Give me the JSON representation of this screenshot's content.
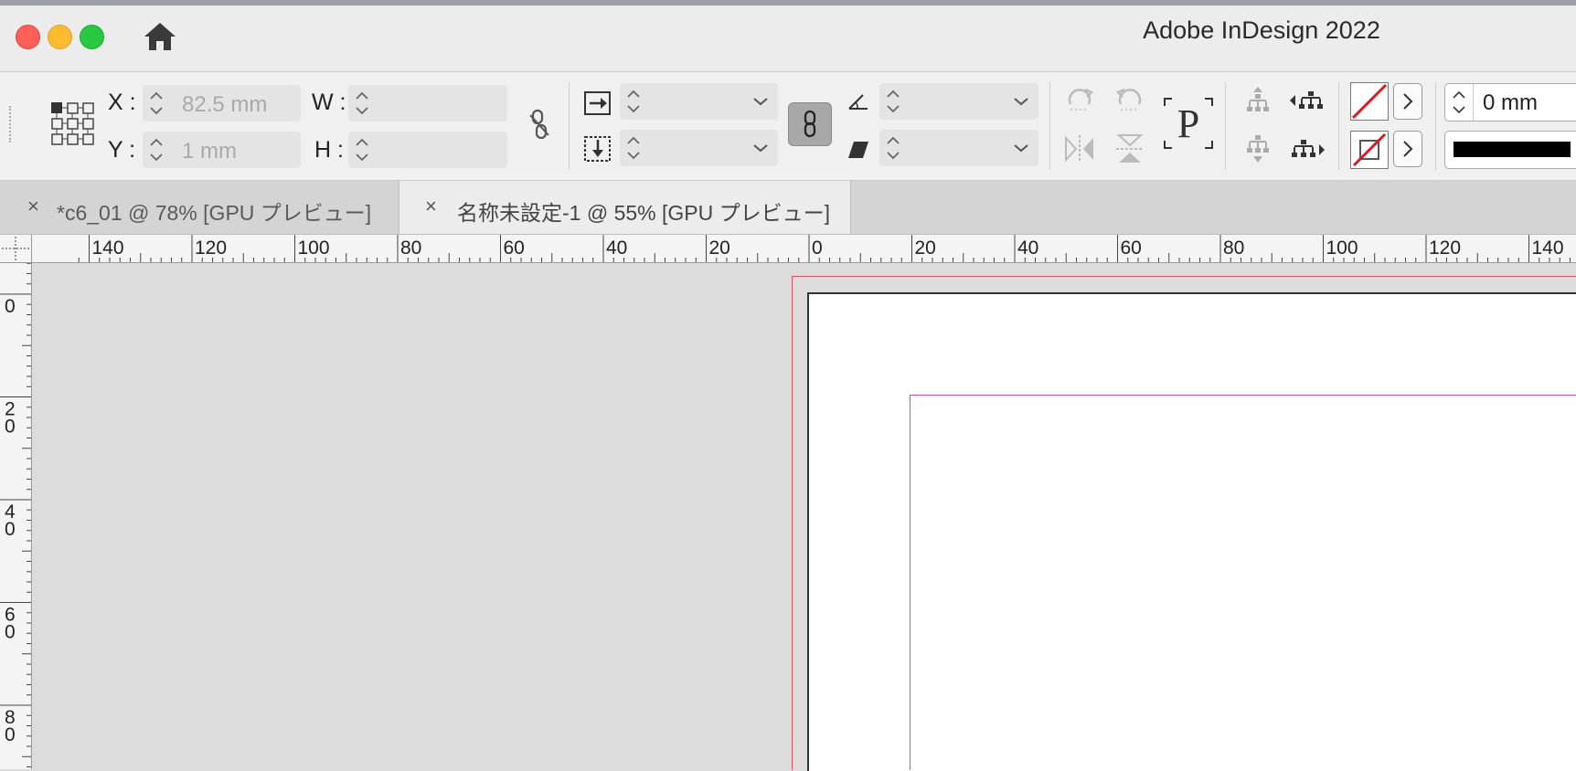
{
  "window": {
    "title": "Adobe InDesign 2022",
    "traffic_lights": {
      "close": "#fe5f57",
      "minimize": "#febc2e",
      "zoom": "#28c840"
    },
    "home_icon": "home-icon"
  },
  "control_bar": {
    "x_label": "X :",
    "x_value": "82.5 mm",
    "y_label": "Y :",
    "y_value": "1 mm",
    "w_label": "W :",
    "w_value": "",
    "h_label": "H :",
    "h_value": "",
    "stroke_weight_value": "0 mm",
    "icons": [
      "reference-point-grid-icon",
      "unlink-proportions-icon",
      "scale-x-icon",
      "scale-y-icon",
      "constrain-link-icon",
      "rotate-angle-icon",
      "shear-angle-icon",
      "rotate-cw-icon",
      "rotate-ccw-icon",
      "flip-horizontal-icon",
      "flip-vertical-icon",
      "paragraph-p-icon",
      "select-container-icon",
      "select-content-icon",
      "select-previous-icon",
      "select-next-icon",
      "fill-none-swatch",
      "stroke-none-swatch"
    ]
  },
  "tabs": [
    {
      "label": "*c6_01 @ 78% [GPU プレビュー]",
      "close": "×",
      "active": false
    },
    {
      "label": "名称未設定-1 @ 55% [GPU プレビュー]",
      "close": "×",
      "active": true
    }
  ],
  "horizontal_ruler": [
    "140",
    "120",
    "100",
    "80",
    "60",
    "40",
    "20",
    "0",
    "20",
    "40",
    "60",
    "80",
    "100",
    "120",
    "140"
  ],
  "vertical_ruler": [
    [
      "0"
    ],
    [
      "2",
      "0"
    ],
    [
      "4",
      "0"
    ],
    [
      "6",
      "0"
    ],
    [
      "8",
      "0"
    ]
  ],
  "colors": {
    "page_border": "#333333",
    "bleed_guide": "#e0525c",
    "margin_guide": "#c64bc6",
    "pasteboard": "#dcdcdc"
  }
}
